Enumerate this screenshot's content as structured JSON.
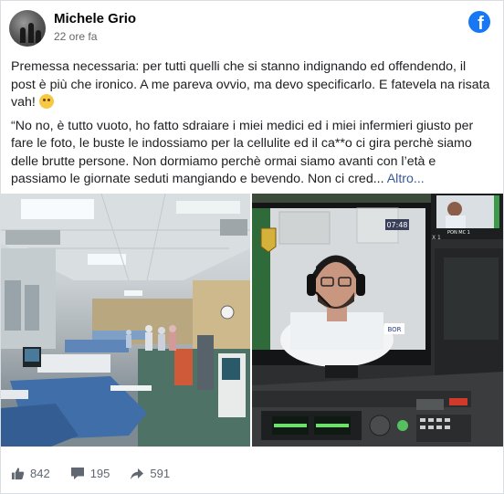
{
  "post": {
    "author": "Michele Grio",
    "timestamp": "22 ore fa",
    "paragraph1": "Premessa necessaria: per tutti quelli che si stanno indignando ed offendendo, il post è più che ironico. A me pareva ovvio, ma devo specificarlo. E fatevela na risata vah!",
    "paragraph2": "“No no, è tutto vuoto, ho fatto sdraiare i miei medici ed i miei infermieri giusto per fare le foto, le buste le indossiamo per la cellulite ed il ca**o ci gira perchè siamo delle brutte persone. Non dormiamo perchè ormai siamo avanti con l’età e passiamo le giornate seduti mangiando e bevendo. Non ci cred...",
    "see_more": "Altro..."
  },
  "photos": {
    "right_screen_time": "07:48",
    "right_screen_logo": "BOR",
    "right_inset_label": "PON MC 1",
    "right_side_label": "X 1"
  },
  "stats": {
    "likes": "842",
    "comments": "195",
    "shares": "591"
  },
  "icons": {
    "brand": "facebook-logo-icon",
    "like": "thumbs-up-icon",
    "comment": "comment-bubble-icon",
    "share": "share-arrow-icon"
  },
  "colors": {
    "facebook_blue": "#1877f2",
    "link": "#385898",
    "muted": "#65676b"
  }
}
